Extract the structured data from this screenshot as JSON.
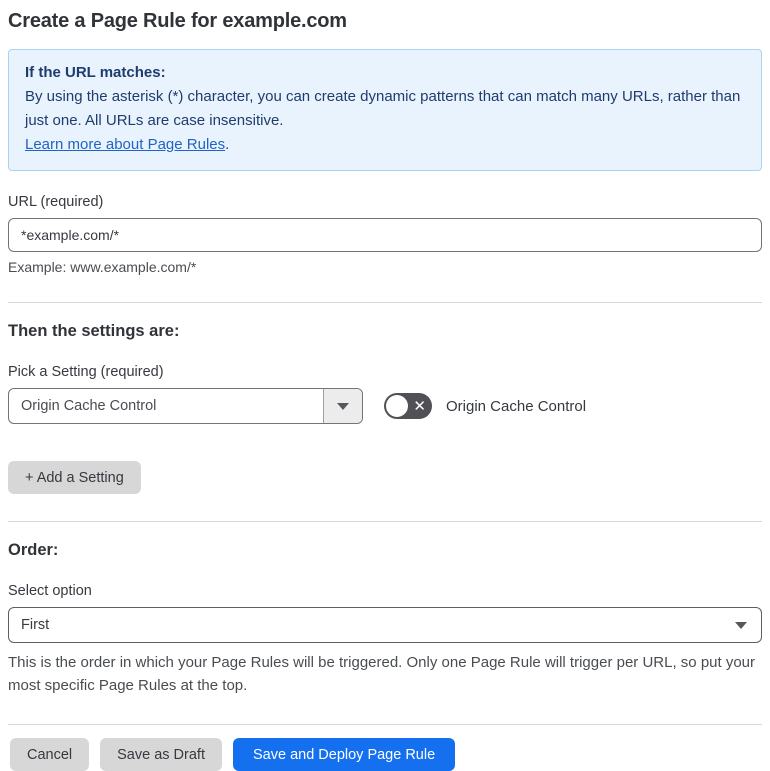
{
  "page_title": "Create a Page Rule for example.com",
  "info_box": {
    "heading": "If the URL matches:",
    "body": "By using the asterisk (*) character, you can create dynamic patterns that can match many URLs, rather than just one. All URLs are case insensitive.",
    "link_text": "Learn more about Page Rules",
    "link_suffix": "."
  },
  "url_section": {
    "label": "URL (required)",
    "input_value": "*example.com/*",
    "helper": "Example: www.example.com/*"
  },
  "settings_section": {
    "heading": "Then the settings are:",
    "picker_label": "Pick a Setting (required)",
    "picker_value": "Origin Cache Control",
    "toggle_state": "off",
    "toggle_label": "Origin Cache Control",
    "toggle_x_glyph": "✕",
    "add_button_label": "+ Add a Setting"
  },
  "order_section": {
    "heading": "Order:",
    "select_label": "Select option",
    "select_value": "First",
    "helper": "This is the order in which your Page Rules will be triggered. Only one Page Rule will trigger per URL, so put your most specific Page Rules at the top."
  },
  "footer": {
    "cancel_label": "Cancel",
    "save_draft_label": "Save as Draft",
    "save_deploy_label": "Save and Deploy Page Rule"
  },
  "colors": {
    "info_background": "#e9f3fd",
    "info_border": "#a9d3f3",
    "info_text": "#1e3c6e",
    "link_blue": "#2163c5",
    "primary_button_blue": "#1570f0",
    "toggle_off_gray": "#515155",
    "secondary_button_gray": "#d7d7d7"
  }
}
